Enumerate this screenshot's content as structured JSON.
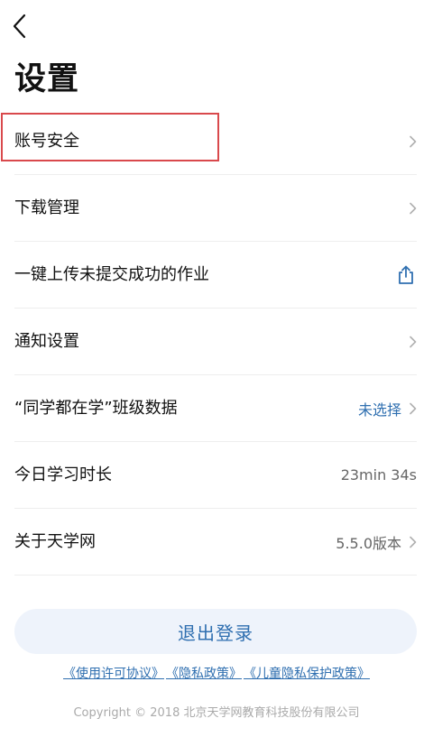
{
  "header": {
    "back_icon": "chevron-left-icon",
    "title": "设置"
  },
  "menu": {
    "items": [
      {
        "label": "账号安全",
        "value": "",
        "icon": "chevron-right-icon"
      },
      {
        "label": "下载管理",
        "value": "",
        "icon": "chevron-right-icon"
      },
      {
        "label": "一键上传未提交成功的作业",
        "value": "",
        "icon": "share-upload-icon"
      },
      {
        "label": "通知设置",
        "value": "",
        "icon": "chevron-right-icon"
      },
      {
        "label": "“同学都在学”班级数据",
        "value": "未选择",
        "icon": "chevron-right-icon"
      },
      {
        "label": "今日学习时长",
        "value": "23min 34s",
        "icon": ""
      },
      {
        "label": "关于天学网",
        "value": "5.5.0版本",
        "icon": "chevron-right-icon"
      }
    ]
  },
  "logout_label": "退出登录",
  "policies": {
    "license": "《使用许可协议》",
    "privacy": "《隐私政策》",
    "child_privacy": "《儿童隐私保护政策》"
  },
  "copyright": "Copyright © 2018 北京天学网教育科技股份有限公司",
  "colors": {
    "accent": "#2f6fb0",
    "highlight": "#d9494c",
    "logout_bg": "#eef3fb"
  }
}
